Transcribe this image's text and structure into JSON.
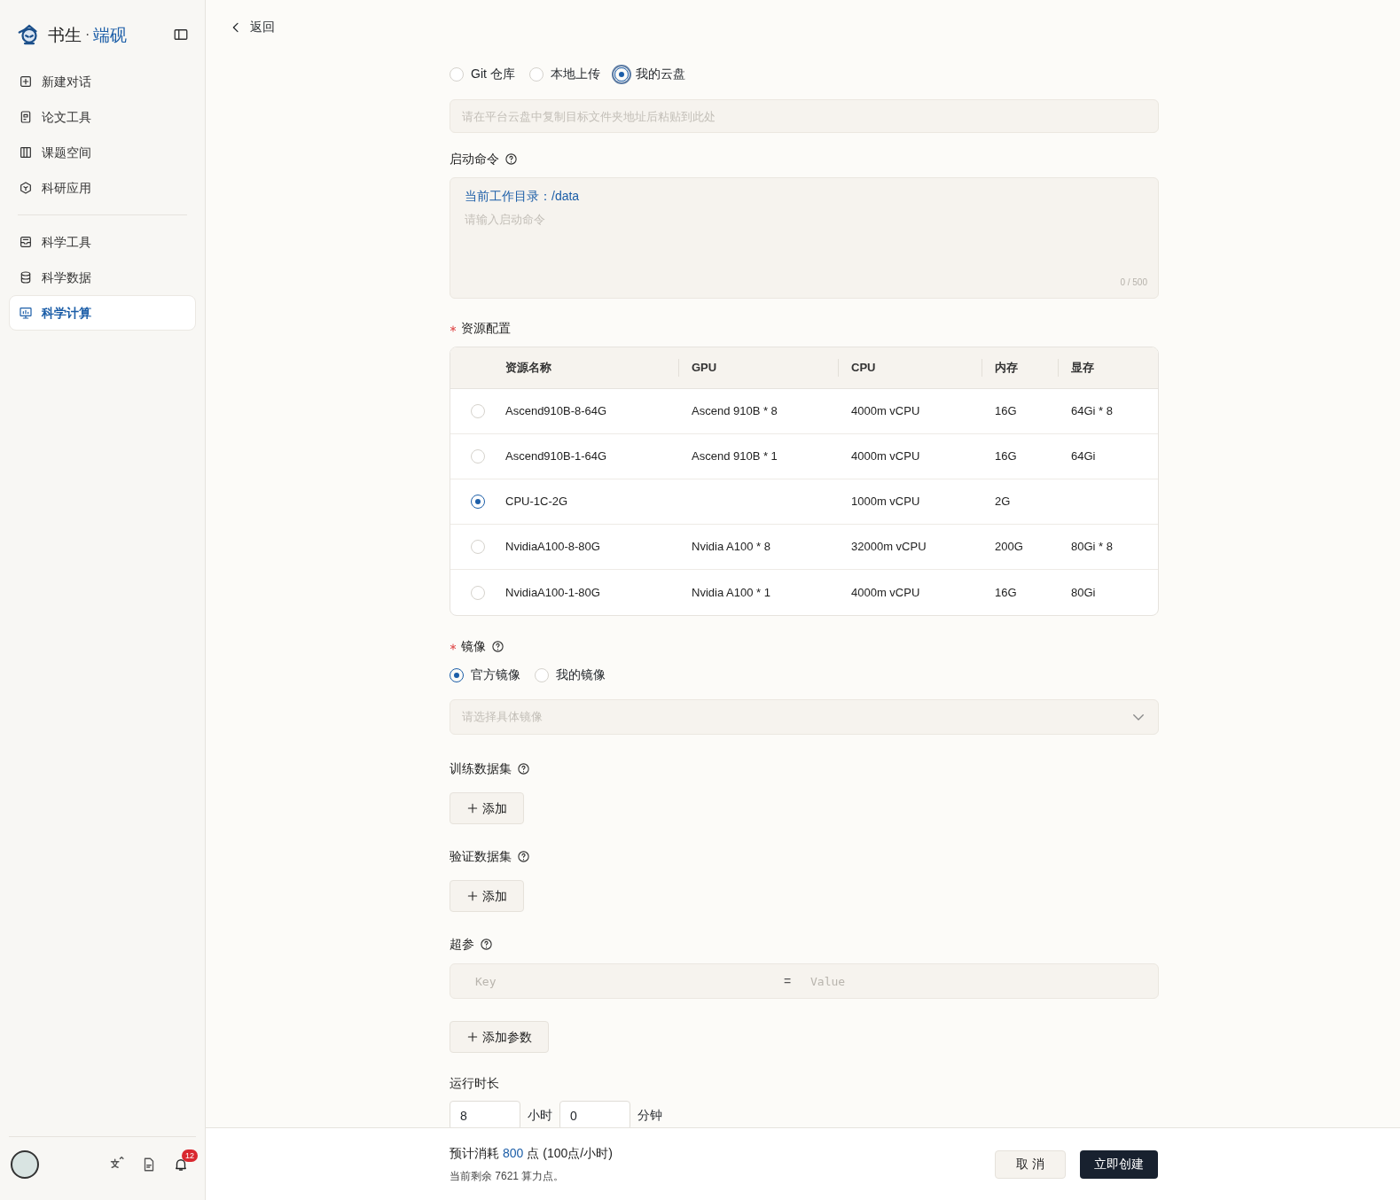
{
  "sidebar": {
    "brand": {
      "left": "书生",
      "separator": "·",
      "right": "端砚"
    },
    "groups": [
      [
        {
          "label": "新建对话",
          "selected": false
        },
        {
          "label": "论文工具",
          "selected": false
        },
        {
          "label": "课题空间",
          "selected": false
        },
        {
          "label": "科研应用",
          "selected": false
        }
      ],
      [
        {
          "label": "科学工具",
          "selected": false
        },
        {
          "label": "科学数据",
          "selected": false
        },
        {
          "label": "科学计算",
          "selected": true
        }
      ]
    ],
    "notification_count": "12"
  },
  "back": "返回",
  "source": {
    "options": [
      {
        "label": "Git 仓库",
        "selected": false
      },
      {
        "label": "本地上传",
        "selected": false
      },
      {
        "label": "我的云盘",
        "selected": true
      }
    ],
    "path_placeholder": "请在平台云盘中复制目标文件夹地址后粘贴到此处"
  },
  "startup": {
    "label": "启动命令",
    "help": true,
    "workdir": "当前工作目录：/data",
    "placeholder": "请输入启动命令",
    "counter": "0 / 500"
  },
  "resources": {
    "label": "资源配置",
    "required": true,
    "columns": [
      "资源名称",
      "GPU",
      "CPU",
      "内存",
      "显存"
    ],
    "rows": [
      {
        "selected": false,
        "cells": [
          "Ascend910B-8-64G",
          "Ascend 910B * 8",
          "4000m vCPU",
          "16G",
          "64Gi * 8"
        ]
      },
      {
        "selected": false,
        "cells": [
          "Ascend910B-1-64G",
          "Ascend 910B * 1",
          "4000m vCPU",
          "16G",
          "64Gi"
        ]
      },
      {
        "selected": true,
        "cells": [
          "CPU-1C-2G",
          null,
          "1000m vCPU",
          "2G",
          null
        ]
      },
      {
        "selected": false,
        "cells": [
          "NvidiaA100-8-80G",
          "Nvidia A100 * 8",
          "32000m vCPU",
          "200G",
          "80Gi * 8"
        ]
      },
      {
        "selected": false,
        "cells": [
          "NvidiaA100-1-80G",
          "Nvidia A100 * 1",
          "4000m vCPU",
          "16G",
          "80Gi"
        ]
      }
    ]
  },
  "image": {
    "label": "镜像",
    "required": true,
    "help": true,
    "options": [
      {
        "label": "官方镜像",
        "selected": true
      },
      {
        "label": "我的镜像",
        "selected": false
      }
    ],
    "select_placeholder": "请选择具体镜像"
  },
  "datasets": [
    {
      "label": "训练数据集",
      "help": true,
      "button": "添加"
    },
    {
      "label": "验证数据集",
      "help": true,
      "button": "添加"
    }
  ],
  "hyperparams": {
    "label": "超参",
    "help": true,
    "key_placeholder": "Key",
    "separator": "=",
    "value_placeholder": "Value",
    "button": "添加参数"
  },
  "duration": {
    "label": "运行时长",
    "hours": "8",
    "hours_unit": "小时",
    "minutes": "0",
    "minutes_unit": "分钟"
  },
  "footer": {
    "estimate_prefix": "预计消耗",
    "estimate_value": "800",
    "estimate_suffix": "点 (100点/小时)",
    "balance": "当前剩余 7621 算力点。",
    "cancel": "取 消",
    "create": "立即创建"
  }
}
